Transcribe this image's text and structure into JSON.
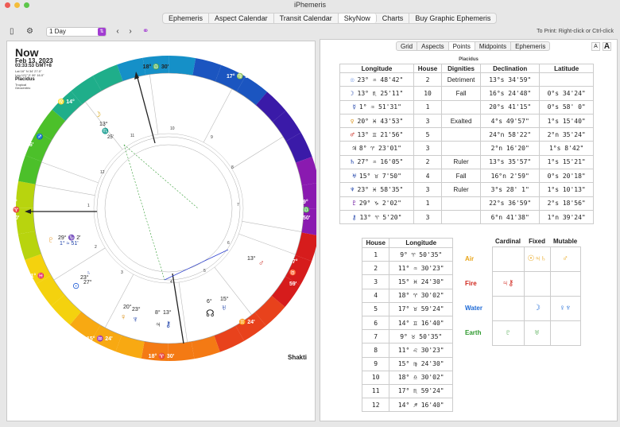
{
  "app": {
    "title": "iPhemeris"
  },
  "tabs": [
    {
      "label": "Ephemeris",
      "active": false
    },
    {
      "label": "Aspect Calendar",
      "active": false
    },
    {
      "label": "Transit Calendar",
      "active": false
    },
    {
      "label": "SkyNow",
      "active": true
    },
    {
      "label": "Charts",
      "active": false
    },
    {
      "label": "Buy Graphic Ephemeris",
      "active": false
    }
  ],
  "toolbar": {
    "sidebar_icon": "▯",
    "gear_icon": "⚙",
    "interval": "1 Day",
    "prev": "‹",
    "next": "›",
    "link_icon": "⚭",
    "print_note": "To Print: Right-click or Ctrl-click"
  },
  "chart_info": {
    "title": "Now",
    "date": "Feb 13, 2023",
    "time": "03:33:53 GMT+8",
    "lat": "Lat 16° N 34' 27.0\"",
    "lng": "Lng 121° E 00' 16.0\"",
    "house_system": "Placidus",
    "zodiac": "Tropical",
    "center": "Geocentric",
    "chart_name": "Shakti"
  },
  "wheel_labels": {
    "top": "18° ♎ 30'",
    "bottom": "18° ♈ 30'",
    "left_deg": "9°",
    "left_sign": "♈",
    "left_min": "50'",
    "right_deg": "9°",
    "right_sign": "♎",
    "right_min": "50'",
    "c2": "17° ♍ 59'",
    "c3": "16° ♌ 14°",
    "c5": "11° ♓ 30'",
    "c6": "15° ♒ 24'",
    "c8": "15° ♊ 24'",
    "c9": "17° ♉ 59'",
    "c10": "16° ♈",
    "c11": "11° ♊ 30'",
    "c12": "14° ♐ 16'"
  },
  "planet_glyphs": {
    "moon": "☽ 13° ♏ 25'",
    "sun": "☉ 23° ♒",
    "mercury": "☿ 1° ♒ 51'",
    "venus": "♀ 20° ♓ 43'",
    "mars": "♂ 13° ♊ 21'",
    "jupiter": "♃ 8° ♈ 23'",
    "saturn": "♄ 23° ♒ 16'",
    "uranus": "♅ 15° ♉ 7'",
    "neptune": "♆ 23° ♓ 58'",
    "pluto": "♇ 29° ♑ 2'",
    "chiron": "⚷ 13° ♈ 5'",
    "node": "☊"
  },
  "subtabs": [
    {
      "label": "Grid",
      "active": false
    },
    {
      "label": "Aspects",
      "active": false
    },
    {
      "label": "Points",
      "active": true
    },
    {
      "label": "Midpoints",
      "active": false
    },
    {
      "label": "Ephemeris",
      "active": false
    }
  ],
  "font_small": "A",
  "font_large": "A",
  "points_table": {
    "title": "Placidus",
    "headers": [
      "Longitude",
      "House",
      "Dignities",
      "Declination",
      "Latitude"
    ],
    "rows": [
      {
        "glyph": "☉",
        "color": "#1e5bd6",
        "lon": "23° ♒ 48'42\"",
        "house": "2",
        "dig": "Detriment",
        "dec": "13°s 34'59\"",
        "lat": ""
      },
      {
        "glyph": "☽",
        "color": "#1b3fa8",
        "lon": "13° ♏ 25'11\"",
        "house": "10",
        "dig": "Fall",
        "dec": "16°s 24'48\"",
        "lat": "0°s 34'24\""
      },
      {
        "glyph": "☿",
        "color": "#1b3fa8",
        "lon": "1° ♒ 51'31\"",
        "house": "1",
        "dig": "",
        "dec": "20°s 41'15\"",
        "lat": "0°s 58' 0\""
      },
      {
        "glyph": "♀",
        "color": "#d88a0a",
        "lon": "20° ♓ 43'53\"",
        "house": "3",
        "dig": "Exalted",
        "dec": "4°s 49'57\"",
        "lat": "1°s 15'40\""
      },
      {
        "glyph": "♂",
        "color": "#c9281e",
        "lon": "13° ♊ 21'56\"",
        "house": "5",
        "dig": "",
        "dec": "24°n 58'22\"",
        "lat": "2°n 35'24\""
      },
      {
        "glyph": "♃",
        "color": "#222",
        "lon": "8° ♈ 23'01\"",
        "house": "3",
        "dig": "",
        "dec": "2°n 16'20\"",
        "lat": "1°s 8'42\""
      },
      {
        "glyph": "♄",
        "color": "#1b3fa8",
        "lon": "27° ♒ 16'05\"",
        "house": "2",
        "dig": "Ruler",
        "dec": "13°s 35'57\"",
        "lat": "1°s 15'21\""
      },
      {
        "glyph": "♅",
        "color": "#1b3fa8",
        "lon": "15° ♉ 7'50\"",
        "house": "4",
        "dig": "Fall",
        "dec": "16°n 2'59\"",
        "lat": "0°s 20'18\""
      },
      {
        "glyph": "♆",
        "color": "#1b3fa8",
        "lon": "23° ♓ 58'35\"",
        "house": "3",
        "dig": "Ruler",
        "dec": "3°s 28' 1\"",
        "lat": "1°s 10'13\""
      },
      {
        "glyph": "♇",
        "color": "#7a2aa8",
        "lon": "29° ♑ 2'02\"",
        "house": "1",
        "dig": "",
        "dec": "22°s 36'59\"",
        "lat": "2°s 18'56\""
      },
      {
        "glyph": "⚷",
        "color": "#1b3fa8",
        "lon": "13° ♈ 5'20\"",
        "house": "3",
        "dig": "",
        "dec": "6°n 41'38\"",
        "lat": "1°n 39'24\""
      }
    ]
  },
  "houses_table": {
    "headers": [
      "House",
      "Longitude"
    ],
    "rows": [
      {
        "house": "1",
        "lon": "9° ♈ 50'35\""
      },
      {
        "house": "2",
        "lon": "11° ♒ 30'23\""
      },
      {
        "house": "3",
        "lon": "15° ♓ 24'30\""
      },
      {
        "house": "4",
        "lon": "18° ♈ 30'02\""
      },
      {
        "house": "5",
        "lon": "17° ♉ 59'24\""
      },
      {
        "house": "6",
        "lon": "14° ♊ 16'40\""
      },
      {
        "house": "7",
        "lon": "9° ♉ 50'35\""
      },
      {
        "house": "8",
        "lon": "11° ♌ 30'23\""
      },
      {
        "house": "9",
        "lon": "15° ♍ 24'30\""
      },
      {
        "house": "10",
        "lon": "18° ♎ 30'02\""
      },
      {
        "house": "11",
        "lon": "17° ♏ 59'24\""
      },
      {
        "house": "12",
        "lon": "14° ♐ 16'40\""
      }
    ]
  },
  "modality_table": {
    "headers": [
      "Cardinal",
      "Fixed",
      "Mutable"
    ],
    "rows": [
      {
        "element": "Air",
        "color": "#e8a417",
        "cardinal": "",
        "fixed": "☉♃♄",
        "mutable": "♂"
      },
      {
        "element": "Fire",
        "color": "#d0261c",
        "cardinal": "♃⚷",
        "fixed": "",
        "mutable": ""
      },
      {
        "element": "Water",
        "color": "#1e6ad6",
        "cardinal": "",
        "fixed": "☽",
        "mutable": "♀♆"
      },
      {
        "element": "Earth",
        "color": "#2f9a2f",
        "cardinal": "♇",
        "fixed": "♅",
        "mutable": ""
      }
    ]
  }
}
